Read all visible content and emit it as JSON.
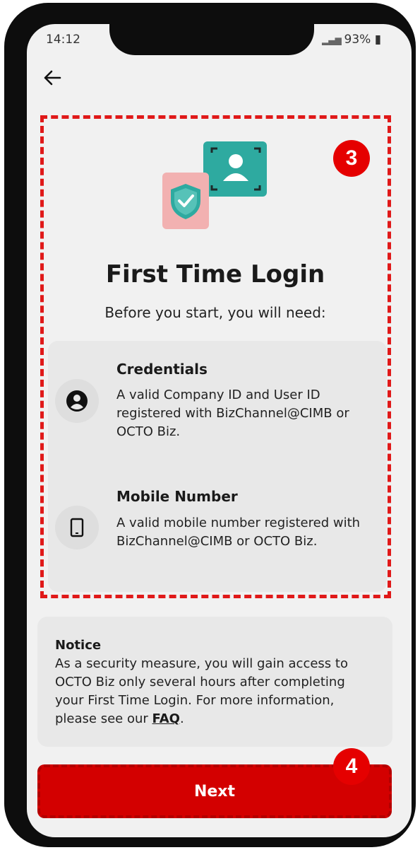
{
  "status_bar": {
    "time": "14:12",
    "battery": "93%"
  },
  "nav": {
    "back_icon": "arrow-left-icon"
  },
  "header": {
    "title": "First Time Login",
    "subtitle": "Before you start, you will need:"
  },
  "requirements": [
    {
      "icon": "user-circle-icon",
      "title": "Credentials",
      "description": "A valid Company ID and User ID registered with BizChannel@CIMB or OCTO Biz."
    },
    {
      "icon": "mobile-phone-icon",
      "title": "Mobile Number",
      "description": "A valid mobile number registered with BizChannel@CIMB or OCTO Biz."
    }
  ],
  "notice": {
    "title": "Notice",
    "body": "As a security measure, you will gain access to OCTO Biz only several hours after completing your First Time Login. For more information, please see our",
    "link": "FAQ",
    "end": "."
  },
  "next_button": {
    "label": "Next"
  },
  "annotations": {
    "step_3": "3",
    "step_4": "4"
  },
  "colors": {
    "accent": "#d30000",
    "badge": "#e50000",
    "teal": "#2eaaa0",
    "pink": "#f2b1b1"
  }
}
